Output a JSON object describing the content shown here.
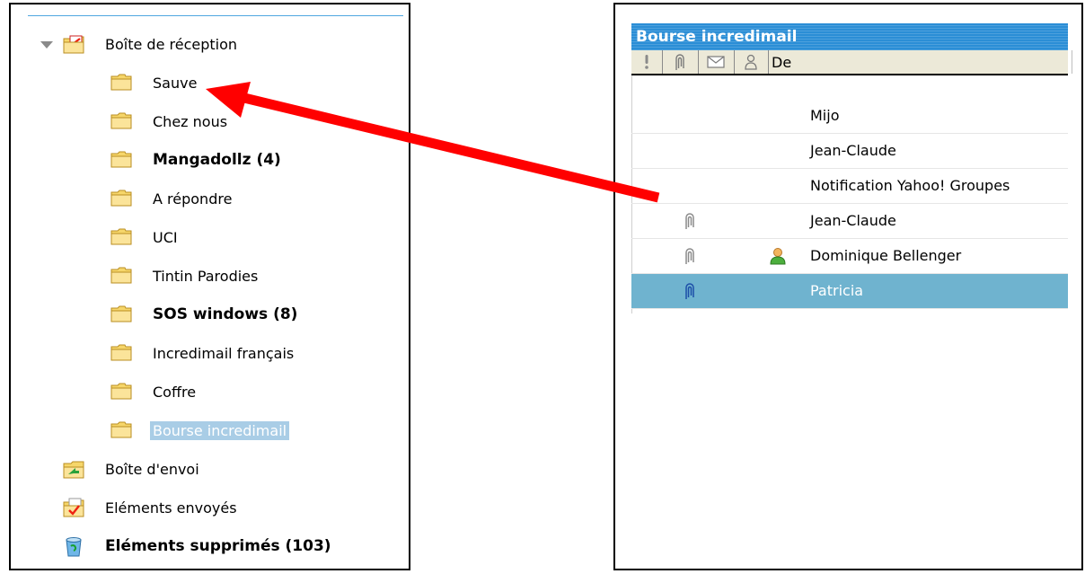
{
  "folder_tree": {
    "items": [
      {
        "label": "Boîte de réception",
        "icon": "inbox-folder-icon",
        "bold": false,
        "selected": false,
        "indent": 0,
        "expander": true
      },
      {
        "label": "Sauve",
        "icon": "folder-icon",
        "bold": false,
        "selected": false,
        "indent": 1
      },
      {
        "label": "Chez nous",
        "icon": "folder-icon",
        "bold": false,
        "selected": false,
        "indent": 1
      },
      {
        "label": "Mangadollz (4)",
        "icon": "folder-icon",
        "bold": true,
        "selected": false,
        "indent": 1
      },
      {
        "label": "A répondre",
        "icon": "folder-icon",
        "bold": false,
        "selected": false,
        "indent": 1
      },
      {
        "label": "UCI",
        "icon": "folder-icon",
        "bold": false,
        "selected": false,
        "indent": 1
      },
      {
        "label": "Tintin Parodies",
        "icon": "folder-icon",
        "bold": false,
        "selected": false,
        "indent": 1
      },
      {
        "label": "SOS windows (8)",
        "icon": "folder-icon",
        "bold": true,
        "selected": false,
        "indent": 1
      },
      {
        "label": "Incredimail français",
        "icon": "folder-icon",
        "bold": false,
        "selected": false,
        "indent": 1
      },
      {
        "label": "Coffre",
        "icon": "folder-icon",
        "bold": false,
        "selected": false,
        "indent": 1
      },
      {
        "label": "Bourse incredimail",
        "icon": "folder-icon",
        "bold": false,
        "selected": true,
        "indent": 1
      },
      {
        "label": "Boîte d'envoi",
        "icon": "outbox-folder-icon",
        "bold": false,
        "selected": false,
        "indent": 0
      },
      {
        "label": "Eléments envoyés",
        "icon": "sent-folder-icon",
        "bold": false,
        "selected": false,
        "indent": 0
      },
      {
        "label": "Eléments supprimés (103)",
        "icon": "trash-icon",
        "bold": true,
        "selected": false,
        "indent": 0
      }
    ]
  },
  "message_list": {
    "title": "Bourse incredimail",
    "columns": [
      {
        "key": "priority",
        "icon": "exclamation-icon"
      },
      {
        "key": "attachment",
        "icon": "paperclip-icon"
      },
      {
        "key": "status",
        "icon": "envelope-icon"
      },
      {
        "key": "contact",
        "icon": "person-icon"
      },
      {
        "key": "from",
        "label": "De"
      }
    ],
    "rows": [
      {
        "from": "Mijo",
        "attachment": false,
        "contact": false,
        "selected": false
      },
      {
        "from": "Jean-Claude",
        "attachment": false,
        "contact": false,
        "selected": false
      },
      {
        "from": "Notification Yahoo! Groupes",
        "attachment": false,
        "contact": false,
        "selected": false
      },
      {
        "from": "Jean-Claude",
        "attachment": true,
        "contact": false,
        "selected": false
      },
      {
        "from": "Dominique Bellenger",
        "attachment": true,
        "contact": true,
        "selected": false
      },
      {
        "from": "Patricia",
        "attachment": true,
        "contact": false,
        "selected": true
      }
    ]
  },
  "colors": {
    "title_bar": "#2b8ed6",
    "selected_row": "#6fb3cf",
    "selected_folder": "#a9cde6",
    "arrow": "#ff0000"
  }
}
